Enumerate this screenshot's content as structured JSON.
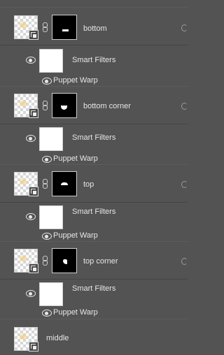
{
  "layers": [
    {
      "name": "bottom",
      "smart_filters": "Smart Filters",
      "filter": "Puppet Warp"
    },
    {
      "name": "bottom corner",
      "smart_filters": "Smart Filters",
      "filter": "Puppet Warp"
    },
    {
      "name": "top",
      "smart_filters": "Smart Filters",
      "filter": "Puppet Warp"
    },
    {
      "name": "top corner",
      "smart_filters": "Smart Filters",
      "filter": "Puppet Warp"
    },
    {
      "name": "middle"
    }
  ],
  "icons": {
    "visibility": "eye-icon",
    "link": "chain-link-icon",
    "smart_object": "smart-object-badge-icon",
    "layer_effects": "layer-effects-icon"
  },
  "colors": {
    "panel_background": "#535353",
    "text": "#e6e6e6"
  }
}
